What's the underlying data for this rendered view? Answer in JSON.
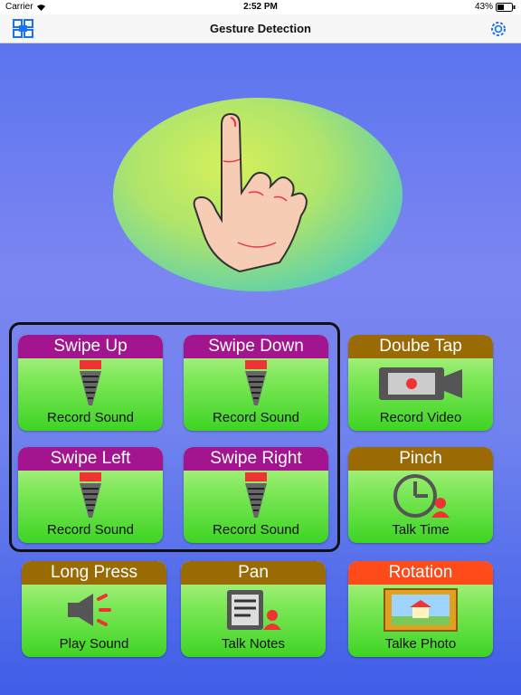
{
  "status": {
    "carrier": "Carrier",
    "time": "2:52 PM",
    "battery": "43%"
  },
  "nav": {
    "title": "Gesture Detection"
  },
  "tiles": [
    {
      "head": "Swipe Up",
      "caption": "Record Sound",
      "icon": "microphone-icon"
    },
    {
      "head": "Swipe Down",
      "caption": "Record Sound",
      "icon": "microphone-icon"
    },
    {
      "head": "Doube Tap",
      "caption": "Record Video",
      "icon": "video-camera-icon"
    },
    {
      "head": "Swipe Left",
      "caption": "Record Sound",
      "icon": "microphone-icon"
    },
    {
      "head": "Swipe Right",
      "caption": "Record Sound",
      "icon": "microphone-icon"
    },
    {
      "head": "Pinch",
      "caption": "Talk Time",
      "icon": "clock-icon"
    },
    {
      "head": "Long Press",
      "caption": "Play Sound",
      "icon": "speaker-icon"
    },
    {
      "head": "Pan",
      "caption": "Talk Notes",
      "icon": "notes-icon"
    },
    {
      "head": "Rotation",
      "caption": "Talke Photo",
      "icon": "photo-icon"
    }
  ],
  "colors": {
    "swipe_header": "#a3158f",
    "gesture_header": "#9a6a05",
    "rotation_header": "#ff4a1a",
    "tile_green": "#3ed424",
    "background_blue": "#6f82ee"
  }
}
